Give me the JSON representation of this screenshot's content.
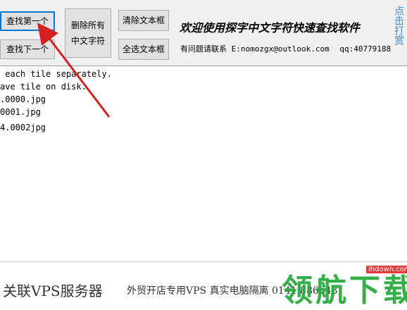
{
  "toolbar": {
    "find_first_label": "查找第一个",
    "find_next_label": "查找下一个",
    "delete_chinese_label_line1": "删除所有",
    "delete_chinese_label_line2": "中文字符",
    "clear_text_label": "清除文本框",
    "select_all_label": "全选文本框"
  },
  "header": {
    "title": "欢迎使用探字中文字符快速查找软件",
    "contact_prefix": "有问题请联系",
    "email": "E:nomozgx@outlook.com",
    "qq": "qq:40779188",
    "side_link": "点击打赏"
  },
  "text_area": {
    "lines": [
      " each tile separately.",
      "ave tile on disk.",
      ".0000.jpg",
      "0001.jpg",
      "4.0002jpg"
    ]
  },
  "footer": {
    "ad_left": "关联VPS服务器",
    "ad_right": "外贸开店专用VPS 真实电脑隔离 0141 886643",
    "logo_text": "领航下载",
    "logo_site": "lhdown.com"
  },
  "colors": {
    "focus_border": "#0078d7",
    "side_link": "#3a8ad6",
    "arrow": "#d62020",
    "logo": "#2bab3e"
  }
}
